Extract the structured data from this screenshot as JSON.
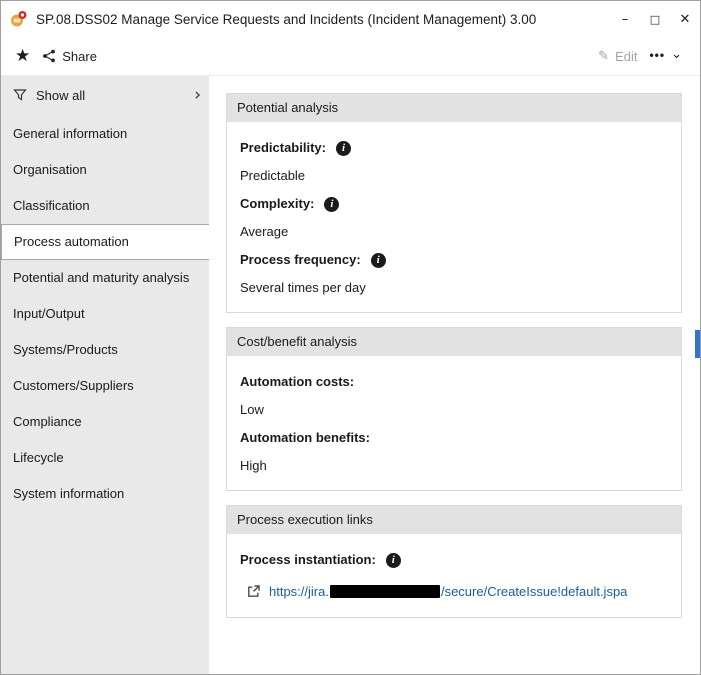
{
  "window": {
    "title": "SP.08.DSS02 Manage Service Requests and Incidents (Incident Management) 3.00"
  },
  "icons": {
    "minimize": "–",
    "maximize": "□",
    "close": "✕",
    "star": "★",
    "pencil": "✎",
    "more_dots": "•••",
    "chevron_down": "⌄",
    "chevron_right": "›",
    "info": "i"
  },
  "toolbar": {
    "share": "Share",
    "edit": "Edit"
  },
  "sidebar": {
    "show_all": "Show all",
    "items": [
      {
        "label": "General information"
      },
      {
        "label": "Organisation"
      },
      {
        "label": "Classification"
      },
      {
        "label": "Process automation"
      },
      {
        "label": "Potential and maturity analysis"
      },
      {
        "label": "Input/Output"
      },
      {
        "label": "Systems/Products"
      },
      {
        "label": "Customers/Suppliers"
      },
      {
        "label": "Compliance"
      },
      {
        "label": "Lifecycle"
      },
      {
        "label": "System information"
      }
    ],
    "selected_index": 3
  },
  "sections": [
    {
      "title": "Potential analysis",
      "fields": [
        {
          "label": "Predictability:",
          "value": "Predictable"
        },
        {
          "label": "Complexity:",
          "value": "Average"
        },
        {
          "label": "Process frequency:",
          "value": "Several times per day"
        }
      ]
    },
    {
      "title": "Cost/benefit analysis",
      "fields": [
        {
          "label": "Automation costs:",
          "value": "Low"
        },
        {
          "label": "Automation benefits:",
          "value": "High"
        }
      ]
    },
    {
      "title": "Process execution links",
      "fields": [
        {
          "label": "Process instantiation:"
        }
      ],
      "link": {
        "prefix": "https://jira.",
        "suffix": "/secure/CreateIssue!default.jspa"
      }
    }
  ]
}
